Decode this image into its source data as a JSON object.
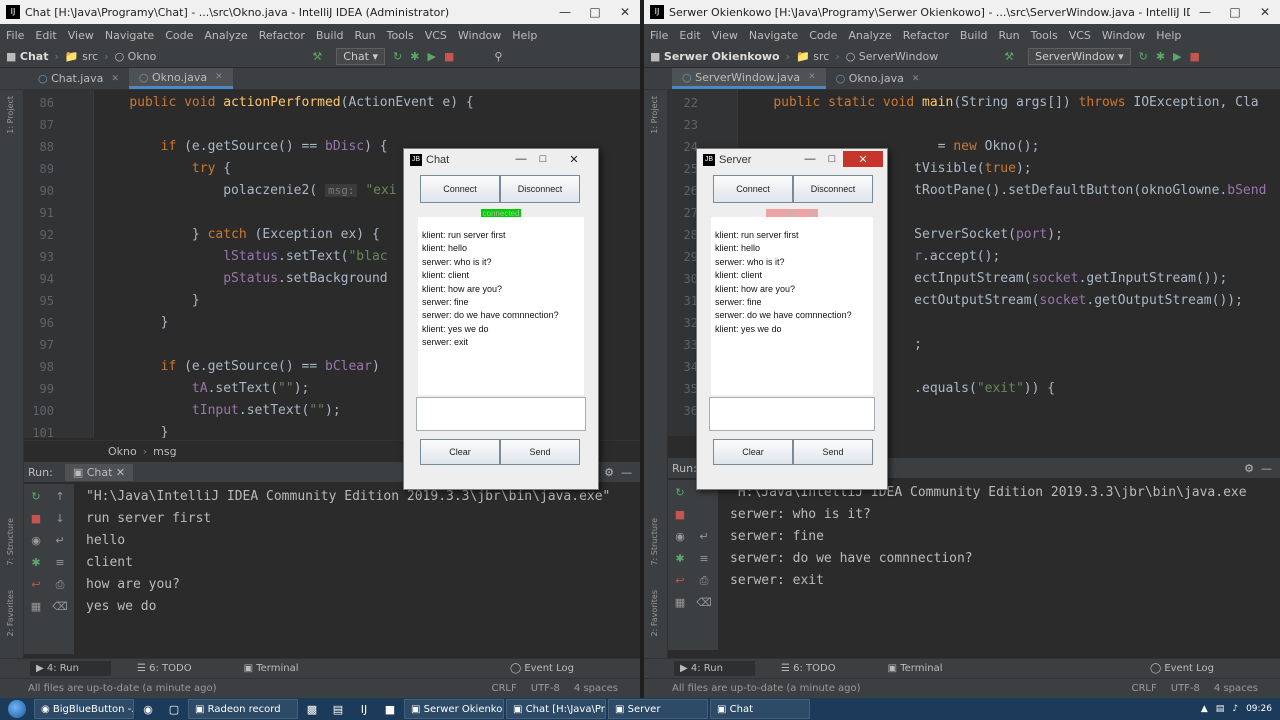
{
  "left": {
    "title": "Chat [H:\\Java\\Programy\\Chat] - ...\\src\\Okno.java - IntelliJ IDEA (Administrator)",
    "menu": [
      "File",
      "Edit",
      "View",
      "Navigate",
      "Code",
      "Analyze",
      "Refactor",
      "Build",
      "Run",
      "Tools",
      "VCS",
      "Window",
      "Help"
    ],
    "nav": {
      "project": "Chat",
      "src": "src",
      "file": "Okno",
      "runcfg": "Chat"
    },
    "tabs": [
      {
        "label": "Chat.java",
        "active": false
      },
      {
        "label": "Okno.java",
        "active": true
      }
    ],
    "lines": [
      {
        "n": "86",
        "html": "    <span class='kw'>public void</span> <span class='fn'>actionPerformed</span>(ActionEvent e) {"
      },
      {
        "n": "87",
        "html": ""
      },
      {
        "n": "88",
        "html": "        <span class='kw'>if</span> (e.getSource() == <span class='fld'>bDisc</span>) {"
      },
      {
        "n": "89",
        "html": "            <span class='kw'>try</span> {"
      },
      {
        "n": "90",
        "html": "                polaczenie2( <span class='hint'>msg:</span> <span class='str'>\"exi</span>"
      },
      {
        "n": "91",
        "html": ""
      },
      {
        "n": "92",
        "html": "            } <span class='kw'>catch</span> (Exception ex) {"
      },
      {
        "n": "93",
        "html": "                <span class='fld'>lStatus</span>.setText(<span class='str'>\"blac</span>"
      },
      {
        "n": "94",
        "html": "                <span class='fld'>pStatus</span>.setBackground"
      },
      {
        "n": "95",
        "html": "            }"
      },
      {
        "n": "96",
        "html": "        }"
      },
      {
        "n": "97",
        "html": ""
      },
      {
        "n": "98",
        "html": "        <span class='kw'>if</span> (e.getSource() == <span class='fld'>bClear</span>)"
      },
      {
        "n": "99",
        "html": "            <span class='fld'>tA</span>.setText(<span class='str'>\"\"</span>);"
      },
      {
        "n": "100",
        "html": "            <span class='fld'>tInput</span>.setText(<span class='str'>\"\"</span>);"
      },
      {
        "n": "101",
        "html": "        }"
      }
    ],
    "crumbs": [
      "Okno",
      "msg"
    ],
    "run_label": "Run:",
    "run_tab": "Chat",
    "console": [
      "\"H:\\Java\\IntelliJ IDEA Community Edition 2019.3.3\\jbr\\bin\\java.exe\"",
      "run server first",
      "hello",
      "client",
      "how are you?",
      "yes we do"
    ],
    "bottom": {
      "run": "4: Run",
      "todo": "6: TODO",
      "terminal": "Terminal",
      "event": "Event Log"
    },
    "status": {
      "msg": "All files are up-to-date (a minute ago)",
      "crlf": "CRLF",
      "enc": "UTF-8",
      "indent": "4 spaces"
    }
  },
  "right": {
    "title": "Serwer Okienkowo [H:\\Java\\Programy\\Serwer Okienkowo] - ...\\src\\ServerWindow.java - IntelliJ IDEA (Administrator)",
    "menu": [
      "File",
      "Edit",
      "View",
      "Navigate",
      "Code",
      "Analyze",
      "Refactor",
      "Build",
      "Run",
      "Tools",
      "VCS",
      "Window",
      "Help"
    ],
    "nav": {
      "project": "Serwer Okienkowo",
      "src": "src",
      "file": "ServerWindow",
      "runcfg": "ServerWindow"
    },
    "tabs": [
      {
        "label": "ServerWindow.java",
        "active": true
      },
      {
        "label": "Okno.java",
        "active": false
      }
    ],
    "lines": [
      {
        "n": "22",
        "html": "    <span class='kw'>public static void</span> <span class='fn'>main</span>(String args[]) <span class='kw'>throws</span> IOException, Cla"
      },
      {
        "n": "23",
        "html": ""
      },
      {
        "n": "24",
        "html": "                         = <span class='kw'>new</span> Okno();"
      },
      {
        "n": "25",
        "html": "                      tVisible(<span class='kw'>true</span>);"
      },
      {
        "n": "26",
        "html": "                      tRootPane().setDefaultButton(oknoGlowne.<span class='fld'>bSend</span>"
      },
      {
        "n": "27",
        "html": ""
      },
      {
        "n": "28",
        "html": "                      ServerSocket(<span class='fld'>port</span>);"
      },
      {
        "n": "29",
        "html": "                      <span class='fld'>r</span>.accept();"
      },
      {
        "n": "30",
        "html": "                      ectInputStream(<span class='fld'>socket</span>.getInputStream());"
      },
      {
        "n": "31",
        "html": "                      ectOutputStream(<span class='fld'>socket</span>.getOutputStream());"
      },
      {
        "n": "32",
        "html": ""
      },
      {
        "n": "33",
        "html": "                      ;"
      },
      {
        "n": "34",
        "html": ""
      },
      {
        "n": "35",
        "html": "                      .equals(<span class='str'>\"exit\"</span>)) {"
      },
      {
        "n": "36",
        "html": ""
      }
    ],
    "run_label": "Run:",
    "console": [
      "\"H:\\Java\\IntelliJ IDEA Community Edition 2019.3.3\\jbr\\bin\\java.exe",
      "serwer: who is it?",
      "serwer: fine",
      "serwer: do we have comnnection?",
      "serwer: exit"
    ],
    "bottom": {
      "run": "4: Run",
      "todo": "6: TODO",
      "terminal": "Terminal",
      "event": "Event Log"
    },
    "status": {
      "msg": "All files are up-to-date (a minute ago)",
      "crlf": "CRLF",
      "enc": "UTF-8",
      "indent": "4 spaces"
    }
  },
  "chat_window": {
    "title": "Chat",
    "connect": "Connect",
    "disconnect": "Disconnect",
    "status": "connected",
    "status_color": "#00cc00",
    "messages": [
      "klient: run server first",
      "klient: hello",
      "serwer: who is it?",
      "klient: client",
      "klient: how are you?",
      "serwer: fine",
      "serwer: do we have comnnection?",
      "klient: yes we do",
      "serwer: exit"
    ],
    "clear": "Clear",
    "send": "Send"
  },
  "server_window": {
    "title": "Server",
    "connect": "Connect",
    "disconnect": "Disconnect",
    "status": "disconnected",
    "status_color": "#f4a0a0",
    "messages": [
      "klient: run server first",
      "klient: hello",
      "serwer: who is it?",
      "klient: client",
      "klient: how are you?",
      "serwer: fine",
      "serwer: do we have comnnection?",
      "klient: yes we do"
    ],
    "clear": "Clear",
    "send": "Send"
  },
  "taskbar": {
    "items": [
      "BigBlueButton -...",
      "Radeon record",
      "Serwer Okienko...",
      "Chat [H:\\Java\\Pr...",
      "Server",
      "Chat"
    ],
    "time": "09:26"
  }
}
